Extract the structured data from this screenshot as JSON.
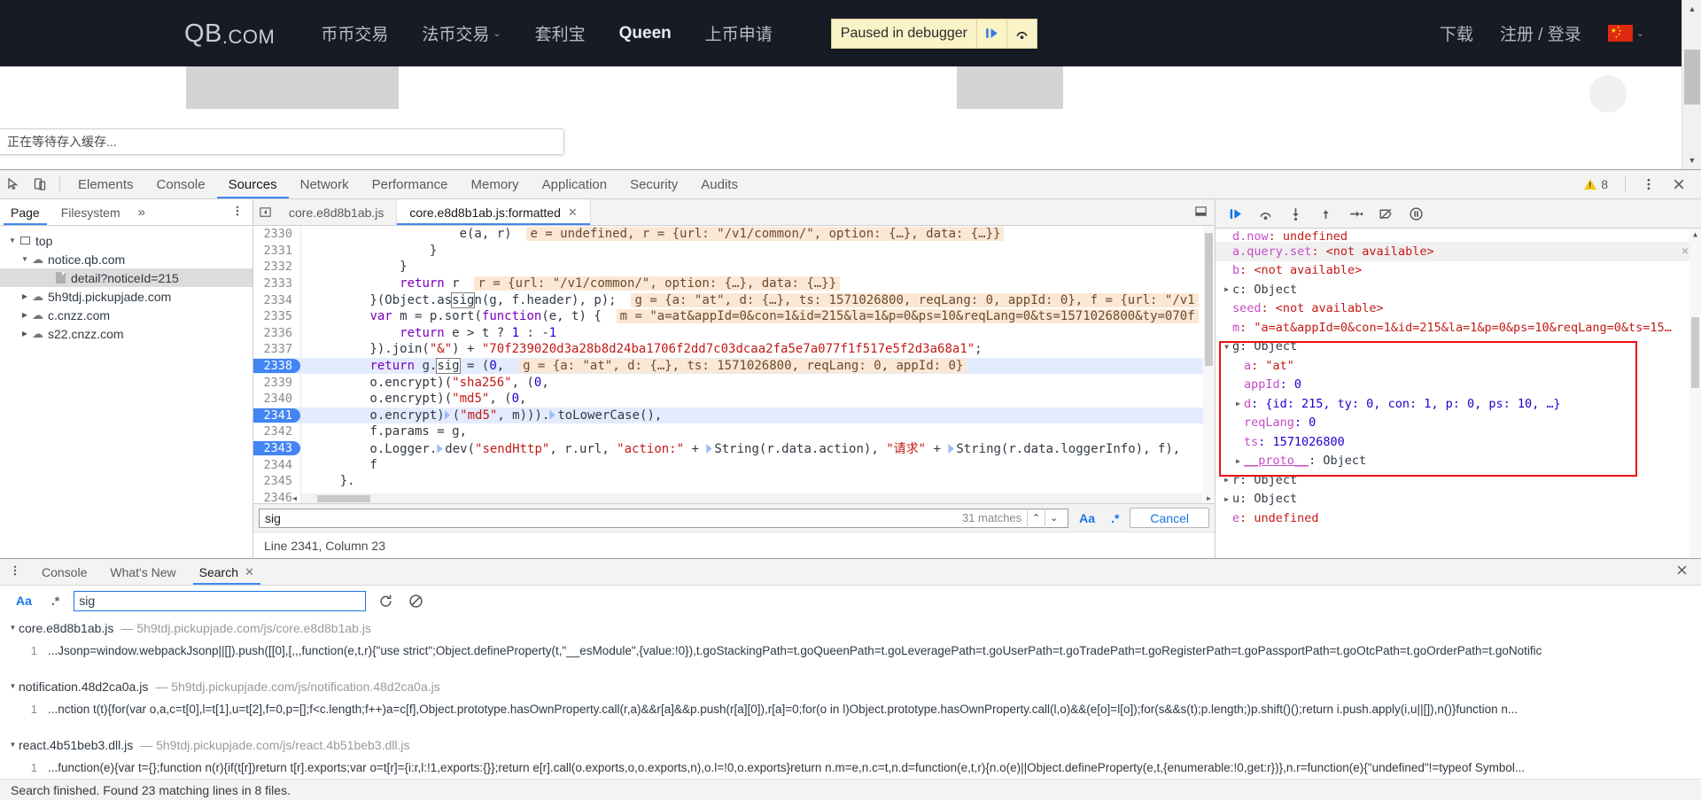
{
  "site": {
    "logo_text": "QB",
    "logo_suffix": ".COM",
    "nav": [
      {
        "label": "币币交易",
        "has_chevron": false,
        "strong": false
      },
      {
        "label": "法币交易",
        "has_chevron": true,
        "strong": false
      },
      {
        "label": "套利宝",
        "has_chevron": false,
        "strong": false
      },
      {
        "label": "Queen",
        "has_chevron": false,
        "strong": true
      },
      {
        "label": "上币申请",
        "has_chevron": false,
        "strong": false
      }
    ],
    "right_nav": [
      {
        "label": "下载"
      },
      {
        "label": "注册 / 登录"
      }
    ],
    "locale_flag": "china-flag-icon",
    "locale_chevron": "⌄",
    "paused_banner": {
      "label": "Paused in debugger",
      "resume_icon": "resume-script-icon",
      "step_icon": "step-over-icon"
    },
    "status_text": "正在等待存入缓存..."
  },
  "devtools": {
    "toolbar": {
      "inspect_icon": "inspect-element-icon",
      "device_icon": "device-toolbar-icon",
      "tabs": [
        {
          "label": "Elements",
          "active": false
        },
        {
          "label": "Console",
          "active": false
        },
        {
          "label": "Sources",
          "active": true
        },
        {
          "label": "Network",
          "active": false
        },
        {
          "label": "Performance",
          "active": false
        },
        {
          "label": "Memory",
          "active": false
        },
        {
          "label": "Application",
          "active": false
        },
        {
          "label": "Security",
          "active": false
        },
        {
          "label": "Audits",
          "active": false
        }
      ],
      "warning_icon": "warning-triangle-icon",
      "warning_count": "8",
      "kebab_icon": "more-options-icon",
      "close_icon": "close-devtools-icon"
    },
    "navigator": {
      "tabs": [
        {
          "label": "Page",
          "active": true
        },
        {
          "label": "Filesystem",
          "active": false
        }
      ],
      "more_icon": "more-tabs-icon",
      "kebab_icon": "navigator-options-icon",
      "tree": [
        {
          "label": "top",
          "depth": 0,
          "icon": "frame-icon",
          "expanded": true,
          "selected": false
        },
        {
          "label": "notice.qb.com",
          "depth": 1,
          "icon": "cloud-icon",
          "expanded": true,
          "selected": false
        },
        {
          "label": "detail?noticeId=215",
          "depth": 2,
          "icon": "document-icon",
          "expanded": null,
          "selected": true
        },
        {
          "label": "5h9tdj.pickupjade.com",
          "depth": 1,
          "icon": "cloud-icon",
          "expanded": false,
          "selected": false
        },
        {
          "label": "c.cnzz.com",
          "depth": 1,
          "icon": "cloud-icon",
          "expanded": false,
          "selected": false
        },
        {
          "label": "s22.cnzz.com",
          "depth": 1,
          "icon": "cloud-icon",
          "expanded": false,
          "selected": false
        }
      ]
    },
    "editor": {
      "back_icon": "tab-navigation-icon",
      "tabs": [
        {
          "label": "core.e8d8b1ab.js",
          "active": false,
          "closable": false
        },
        {
          "label": "core.e8d8b1ab.js:formatted",
          "active": true,
          "closable": true
        }
      ],
      "popout_icon": "popout-drawer-icon",
      "lines": [
        {
          "num": "2330",
          "state": "",
          "text": "                    e(a, r)",
          "hint": "e = undefined, r = {url: \"/v1/common/\", option: {…}, data: {…}}"
        },
        {
          "num": "2331",
          "state": "",
          "text": "                }",
          "hint": ""
        },
        {
          "num": "2332",
          "state": "",
          "text": "            }",
          "hint": ""
        },
        {
          "num": "2333",
          "state": "",
          "text": "            return r",
          "hint": "r = {url: \"/v1/common/\", option: {…}, data: {…}}"
        },
        {
          "num": "2334",
          "state": "",
          "text": "        }(Object.assign(g, f.header), p);",
          "hint": "g = {a: \"at\", d: {…}, ts: 1571026800, reqLang: 0, appId: 0}, f = {url: \"/v1"
        },
        {
          "num": "2335",
          "state": "",
          "text": "        var m = p.sort(function(e, t) {",
          "hint": "m = \"a=at&appId=0&con=1&id=215&la=1&p=0&ps=10&reqLang=0&ts=1571026800&ty=070f"
        },
        {
          "num": "2336",
          "state": "",
          "text": "            return e > t ? 1 : -1",
          "hint": ""
        },
        {
          "num": "2337",
          "state": "",
          "text": "        }).join(\"&\") + \"70f239020d3a28b8d24ba1706f2dd7c03dcaa2fa5e7a077f1f517e5f2d3a68a1\";",
          "hint": ""
        },
        {
          "num": "2338",
          "state": "exec",
          "text": "        return g.sig = (0,",
          "hint": "g = {a: \"at\", d: {…}, ts: 1571026800, reqLang: 0, appId: 0}"
        },
        {
          "num": "2339",
          "state": "",
          "text": "        o.encrypt)(\"sha256\", (0,",
          "hint": ""
        },
        {
          "num": "2340",
          "state": "",
          "text": "        o.encrypt)(\"md5\", (0,",
          "hint": ""
        },
        {
          "num": "2341",
          "state": "bp",
          "text": "        o.encrypt)(\"md5\", m))).toLowerCase(),",
          "hint": ""
        },
        {
          "num": "2342",
          "state": "",
          "text": "        f.params = g,",
          "hint": ""
        },
        {
          "num": "2343",
          "state": "bp",
          "text": "        o.Logger.dev(\"sendHttp\", r.url, \"action:\" + String(r.data.action), \"请求\" + String(r.data.loggerInfo), f),",
          "hint": ""
        },
        {
          "num": "2344",
          "state": "",
          "text": "        f",
          "hint": ""
        },
        {
          "num": "2345",
          "state": "",
          "text": "    }.",
          "hint": ""
        },
        {
          "num": "2346",
          "state": "",
          "text": "",
          "hint": ""
        }
      ],
      "find": {
        "query": "sig",
        "matches": "31 matches",
        "prev_icon": "find-previous-icon",
        "next_icon": "find-next-icon",
        "match_case_label": "Aa",
        "regex_label": ".*",
        "cancel_label": "Cancel"
      },
      "status": "Line 2341, Column 23"
    },
    "debugger": {
      "toolbar": [
        {
          "icon": "resume-script-icon",
          "name": "resume-button"
        },
        {
          "icon": "step-over-icon",
          "name": "step-over-button"
        },
        {
          "icon": "step-into-icon",
          "name": "step-into-button"
        },
        {
          "icon": "step-out-icon",
          "name": "step-out-button"
        },
        {
          "icon": "step-icon",
          "name": "step-button"
        },
        {
          "icon": "deactivate-breakpoints-icon",
          "name": "deactivate-breakpoints-button"
        },
        {
          "icon": "pause-on-exceptions-icon",
          "name": "pause-on-exceptions-button"
        }
      ],
      "scope": [
        {
          "indent": 1,
          "tri": "",
          "key": "d.now",
          "value": ": undefined",
          "value_type": "red",
          "shaded": false,
          "cut": true
        },
        {
          "indent": 1,
          "tri": "",
          "key": "a.query.set",
          "value": ": <not available>",
          "value_type": "red",
          "shaded": true,
          "close": true
        },
        {
          "indent": 1,
          "tri": "",
          "key": "b",
          "value": ": <not available>",
          "value_type": "red",
          "shaded": false
        },
        {
          "indent": 0,
          "tri": "▶",
          "key": "c",
          "value": ": Object",
          "value_type": "obj",
          "shaded": false,
          "key_dark": true
        },
        {
          "indent": 1,
          "tri": "",
          "key": "seed",
          "value": ": <not available>",
          "value_type": "red",
          "shaded": false
        },
        {
          "indent": 1,
          "tri": "",
          "key": "m",
          "value": ": \"a=at&appId=0&con=1&id=215&la=1&p=0&ps=10&reqLang=0&ts=15…",
          "value_type": "red",
          "shaded": false
        },
        {
          "indent": 0,
          "tri": "▼",
          "key": "g",
          "value": ": Object",
          "value_type": "obj",
          "shaded": false,
          "key_dark": true,
          "boxed": true
        },
        {
          "indent": 2,
          "tri": "",
          "key": "a",
          "value": ": \"at\"",
          "value_type": "red",
          "shaded": false,
          "boxed": true
        },
        {
          "indent": 2,
          "tri": "",
          "key": "appId",
          "value": ": 0",
          "value_type": "num",
          "shaded": false,
          "boxed": true
        },
        {
          "indent": 1,
          "tri": "▶",
          "key": "d",
          "value": ": {id: 215, ty: 0, con: 1, p: 0, ps: 10, …}",
          "value_type": "mixed",
          "shaded": false,
          "boxed": true
        },
        {
          "indent": 2,
          "tri": "",
          "key": "reqLang",
          "value": ": 0",
          "value_type": "num",
          "shaded": false,
          "boxed": true
        },
        {
          "indent": 2,
          "tri": "",
          "key": "ts",
          "value": ": 1571026800",
          "value_type": "num",
          "shaded": false,
          "boxed": true
        },
        {
          "indent": 1,
          "tri": "▶",
          "key": "__proto__",
          "value": ": Object",
          "value_type": "obj",
          "shaded": false,
          "boxed": true
        },
        {
          "indent": 0,
          "tri": "▶",
          "key": "r",
          "value": ": Object",
          "value_type": "obj",
          "shaded": false,
          "key_dark": true
        },
        {
          "indent": 0,
          "tri": "▶",
          "key": "u",
          "value": ": Object",
          "value_type": "obj",
          "shaded": false,
          "key_dark": true
        },
        {
          "indent": 1,
          "tri": "",
          "key": "e",
          "value": ": undefined",
          "value_type": "red",
          "shaded": false
        }
      ]
    },
    "drawer": {
      "kebab_icon": "drawer-options-icon",
      "tabs": [
        {
          "label": "Console",
          "active": false,
          "closable": false
        },
        {
          "label": "What's New",
          "active": false,
          "closable": false
        },
        {
          "label": "Search",
          "active": true,
          "closable": true
        }
      ],
      "close_icon": "close-drawer-icon",
      "search": {
        "match_case_label": "Aa",
        "regex_label": ".*",
        "query": "sig",
        "refresh_icon": "refresh-search-icon",
        "clear_icon": "clear-search-icon"
      },
      "results": [
        {
          "file": "core.e8d8b1ab.js",
          "url": "5h9tdj.pickupjade.com/js/core.e8d8b1ab.js",
          "lines": [
            {
              "num": "1",
              "code": "...Jsonp=window.webpackJsonp||[]).push([[0],[,,,function(e,t,r){\"use strict\";Object.defineProperty(t,\"__esModule\",{value:!0}),t.goStackingPath=t.goQueenPath=t.goLeveragePath=t.goUserPath=t.goTradePath=t.goRegisterPath=t.goPassportPath=t.goOtcPath=t.goOrderPath=t.goNotific"
            }
          ]
        },
        {
          "file": "notification.48d2ca0a.js",
          "url": "5h9tdj.pickupjade.com/js/notification.48d2ca0a.js",
          "lines": [
            {
              "num": "1",
              "code": "...nction t(t){for(var o,a,c=t[0],l=t[1],u=t[2],f=0,p=[];f<c.length;f++)a=c[f],Object.prototype.hasOwnProperty.call(r,a)&&r[a]&&p.push(r[a][0]),r[a]=0;for(o in l)Object.prototype.hasOwnProperty.call(l,o)&&(e[o]=l[o]);for(s&&s(t);p.length;)p.shift()();return i.push.apply(i,u||[]),n()}function n..."
            }
          ]
        },
        {
          "file": "react.4b51beb3.dll.js",
          "url": "5h9tdj.pickupjade.com/js/react.4b51beb3.dll.js",
          "lines": [
            {
              "num": "1",
              "code": "...function(e){var t={};function n(r){if(t[r])return t[r].exports;var o=t[r]={i:r,l:!1,exports:{}};return e[r].call(o.exports,o,o.exports,n),o.l=!0,o.exports}return n.m=e,n.c=t,n.d=function(e,t,r){n.o(e)||Object.defineProperty(e,t,{enumerable:!0,get:r})},n.r=function(e){\"undefined\"!=typeof Symbol..."
            }
          ]
        }
      ],
      "status": "Search finished. Found 23 matching lines in 8 files."
    }
  }
}
